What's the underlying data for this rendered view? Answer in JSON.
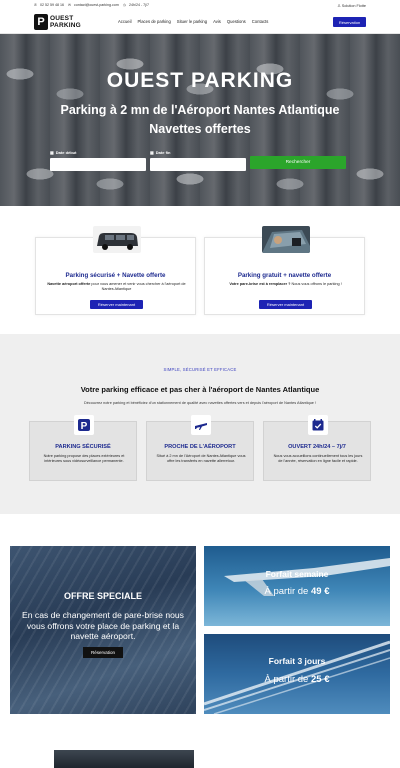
{
  "header": {
    "phone": "02 52 59 48 16",
    "email": "contact@ouest-parking.com",
    "hours": "24h/24 - 7j/7",
    "solution_link": "Solution Flotte",
    "logo_line1": "OUEST",
    "logo_line2": "PARKING",
    "logo_mark": "P",
    "nav": [
      "Accueil",
      "Places de parking",
      "Situer le parking",
      "Avis",
      "Questions",
      "Contacts"
    ],
    "reserve_button": "Réservation"
  },
  "hero": {
    "title": "OUEST PARKING",
    "subtitle_line1": "Parking à 2 mn de l'Aéroport Nantes Atlantique",
    "subtitle_line2": "Navettes offertes",
    "label_start": "Date début",
    "label_end": "Date fin",
    "search_button": "Rechercher"
  },
  "cards": [
    {
      "title": "Parking sécurisé + Navette offerte",
      "text_bold": "Navette aéroport offerte",
      "text_rest": " pour vous amener et venir vous chercher à l'aéroport de Nantes Atlantique",
      "button": "Réserver maintenant"
    },
    {
      "title": "Parking gratuit + navette offerte",
      "text_bold": "Votre pare-brise est à remplacer ?",
      "text_rest": " Nous vous offrons le parking !",
      "button": "Réserver maintenant"
    }
  ],
  "features": {
    "kicker": "SIMPLE, SÉCURISÉ ET EFFICACE",
    "title": "Votre parking efficace et pas cher à l'aéroport de Nantes Atlantique",
    "description": "Découvrez notre parking et bénéficiez d'un stationnement de qualité avec navettes offertes vers et depuis l'aéroport de Nantes Atlantique !",
    "items": [
      {
        "title": "PARKING SÉCURISÉ",
        "text": "Notre parking propose des places extérieures et intérieures sous vidéosurveillance permanente."
      },
      {
        "title": "PROCHE DE L'AÉROPORT",
        "text": "Situé à 2 mn de l'Aéroport de Nantes Atlantique vous offre les transferts en navette allerretour."
      },
      {
        "title": "OUVERT 24h/24 – 7j/7",
        "text": "Nous vous accueillons continuellement tous les jours de l'année, réservation en ligne facile et rapide."
      }
    ]
  },
  "offers": {
    "special_title": "OFFRE SPECIALE",
    "special_text": "En cas de changement de pare-brise nous vous offrons  votre place de parking et la navette aéroport.",
    "special_button": "Réservation",
    "week_title": "Forfait semaine",
    "week_price_prefix": "À partir de ",
    "week_price": "49 €",
    "days_title": "Forfait 3 jours",
    "days_price_prefix": "À partir de ",
    "days_price": "25 €"
  },
  "colors": {
    "accent_blue": "#1d23b4",
    "title_blue": "#1d2a8f",
    "search_green": "#2ba52b"
  }
}
